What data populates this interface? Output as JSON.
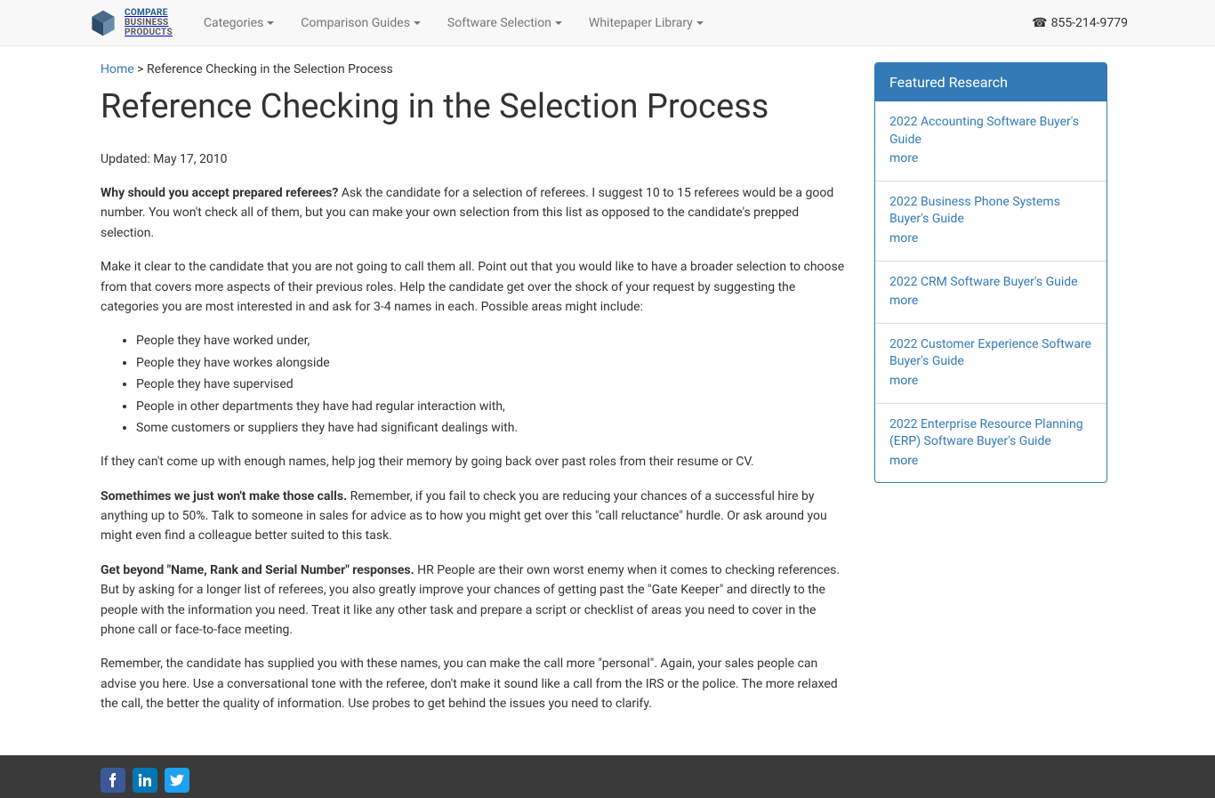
{
  "brand": {
    "line1": "COMPARE",
    "line2": "BUSINESS",
    "line3": "PRODUCTS"
  },
  "nav": {
    "items": [
      {
        "label": "Categories"
      },
      {
        "label": "Comparison Guides"
      },
      {
        "label": "Software Selection"
      },
      {
        "label": "Whitepaper Library"
      }
    ]
  },
  "phone": "855-214-9779",
  "breadcrumb": {
    "home": "Home",
    "sep": " > ",
    "current": "Reference Checking in the Selection Process"
  },
  "page": {
    "title": "Reference Checking in the Selection Process",
    "updated": "Updated: May 17, 2010",
    "p1_strong": "Why should you accept prepared referees?",
    "p1_rest": " Ask the candidate for a selection of referees. I suggest 10 to 15 referees would be a good number. You won't check all of them, but you can make your own selection from this list as opposed to the candidate's prepped selection.",
    "p2": "Make it clear to the candidate that you are not going to call them all. Point out that you would like to have a broader selection to choose from that covers more aspects of their previous roles. Help the candidate get over the shock of your request by suggesting the categories you are most interested in and ask for 3-4 names in each. Possible areas might include:",
    "bullets": [
      "People they have worked under,",
      "People they have workes alongside",
      "People they have supervised",
      "People in other departments they have had regular interaction with,",
      "Some customers or suppliers they have had significant dealings with."
    ],
    "p3": "If they can't come up with enough names, help jog their memory by going back over past roles from their resume or CV.",
    "p4_strong": "Somethimes we just won't make those calls.",
    "p4_rest": " Remember, if you fail to check you are reducing your chances of a successful hire by anything up to 50%. Talk to someone in sales for advice as to how you might get over this \"call reluctance\" hurdle. Or ask around you might even find a colleague better suited to this task.",
    "p5_strong": "Get beyond \"Name, Rank and Serial Number\" responses.",
    "p5_rest": " HR People are their own worst enemy when it comes to checking references. But by asking for a longer list of referees, you also greatly improve your chances of getting past the \"Gate Keeper\" and directly to the people with the information you need. Treat it like any other task and prepare a script or checklist of areas you need to cover in the phone call or face-to-face meeting.",
    "p6": "Remember, the candidate has supplied you with these names, you can make the call more \"personal\". Again, your sales people can advise you here. Use a conversational tone with the referee, don't make it sound like a call from the IRS or the police. The more relaxed the call, the better the quality of information. Use probes to get behind the issues you need to clarify."
  },
  "sidebar": {
    "heading": "Featured Research",
    "more": "more",
    "items": [
      {
        "title": "2022 Accounting Software Buyer's Guide"
      },
      {
        "title": "2022 Business Phone Systems Buyer's Guide"
      },
      {
        "title": "2022 CRM Software Buyer's Guide"
      },
      {
        "title": "2022 Customer Experience Software Buyer's Guide"
      },
      {
        "title": "2022 Enterprise Resource Planning (ERP) Software Buyer's Guide"
      }
    ]
  }
}
